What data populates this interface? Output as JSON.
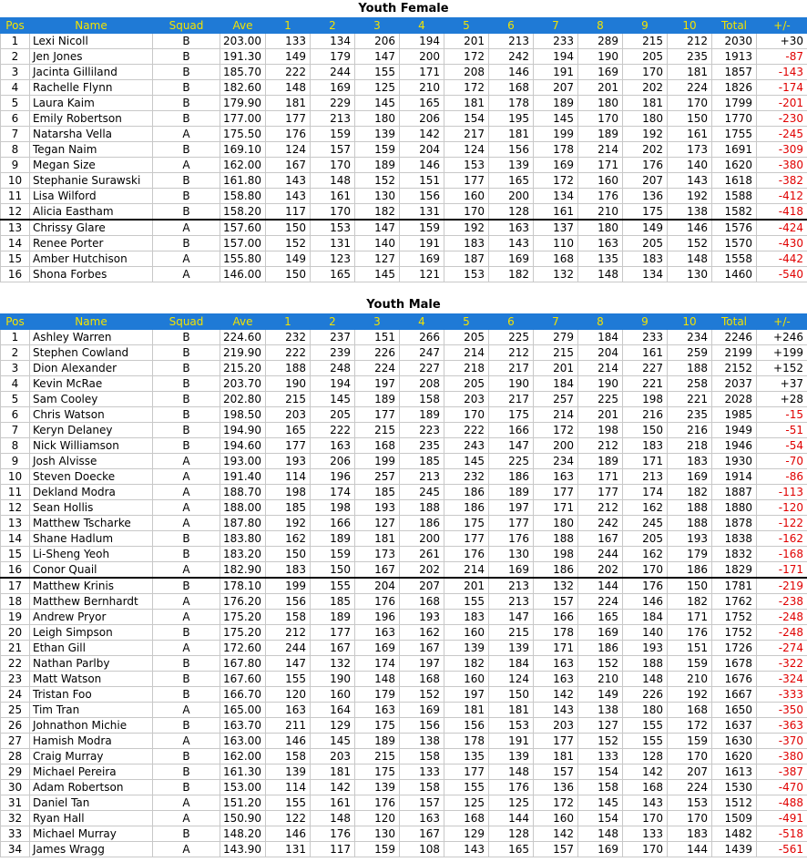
{
  "headers": [
    "Pos",
    "Name",
    "Squad",
    "Ave",
    "1",
    "2",
    "3",
    "4",
    "5",
    "6",
    "7",
    "8",
    "9",
    "10",
    "Total",
    "+/-"
  ],
  "sections": [
    {
      "title": "Youth Female",
      "cut_after": 12,
      "rows": [
        [
          "1",
          "Lexi Nicoll",
          "B",
          "203.00",
          "133",
          "134",
          "206",
          "194",
          "201",
          "213",
          "233",
          "289",
          "215",
          "212",
          "2030",
          "+30"
        ],
        [
          "2",
          "Jen Jones",
          "B",
          "191.30",
          "149",
          "179",
          "147",
          "200",
          "172",
          "242",
          "194",
          "190",
          "205",
          "235",
          "1913",
          "-87"
        ],
        [
          "3",
          "Jacinta Gilliland",
          "B",
          "185.70",
          "222",
          "244",
          "155",
          "171",
          "208",
          "146",
          "191",
          "169",
          "170",
          "181",
          "1857",
          "-143"
        ],
        [
          "4",
          "Rachelle Flynn",
          "B",
          "182.60",
          "148",
          "169",
          "125",
          "210",
          "172",
          "168",
          "207",
          "201",
          "202",
          "224",
          "1826",
          "-174"
        ],
        [
          "5",
          "Laura Kaim",
          "B",
          "179.90",
          "181",
          "229",
          "145",
          "165",
          "181",
          "178",
          "189",
          "180",
          "181",
          "170",
          "1799",
          "-201"
        ],
        [
          "6",
          "Emily Robertson",
          "B",
          "177.00",
          "177",
          "213",
          "180",
          "206",
          "154",
          "195",
          "145",
          "170",
          "180",
          "150",
          "1770",
          "-230"
        ],
        [
          "7",
          "Natarsha Vella",
          "A",
          "175.50",
          "176",
          "159",
          "139",
          "142",
          "217",
          "181",
          "199",
          "189",
          "192",
          "161",
          "1755",
          "-245"
        ],
        [
          "8",
          "Tegan Naim",
          "B",
          "169.10",
          "124",
          "157",
          "159",
          "204",
          "124",
          "156",
          "178",
          "214",
          "202",
          "173",
          "1691",
          "-309"
        ],
        [
          "9",
          "Megan Size",
          "A",
          "162.00",
          "167",
          "170",
          "189",
          "146",
          "153",
          "139",
          "169",
          "171",
          "176",
          "140",
          "1620",
          "-380"
        ],
        [
          "10",
          "Stephanie Surawski",
          "B",
          "161.80",
          "143",
          "148",
          "152",
          "151",
          "177",
          "165",
          "172",
          "160",
          "207",
          "143",
          "1618",
          "-382"
        ],
        [
          "11",
          "Lisa Wilford",
          "B",
          "158.80",
          "143",
          "161",
          "130",
          "156",
          "160",
          "200",
          "134",
          "176",
          "136",
          "192",
          "1588",
          "-412"
        ],
        [
          "12",
          "Alicia Eastham",
          "B",
          "158.20",
          "117",
          "170",
          "182",
          "131",
          "170",
          "128",
          "161",
          "210",
          "175",
          "138",
          "1582",
          "-418"
        ],
        [
          "13",
          "Chrissy Glare",
          "A",
          "157.60",
          "150",
          "153",
          "147",
          "159",
          "192",
          "163",
          "137",
          "180",
          "149",
          "146",
          "1576",
          "-424"
        ],
        [
          "14",
          "Renee Porter",
          "B",
          "157.00",
          "152",
          "131",
          "140",
          "191",
          "183",
          "143",
          "110",
          "163",
          "205",
          "152",
          "1570",
          "-430"
        ],
        [
          "15",
          "Amber Hutchison",
          "A",
          "155.80",
          "149",
          "123",
          "127",
          "169",
          "187",
          "169",
          "168",
          "135",
          "183",
          "148",
          "1558",
          "-442"
        ],
        [
          "16",
          "Shona Forbes",
          "A",
          "146.00",
          "150",
          "165",
          "145",
          "121",
          "153",
          "182",
          "132",
          "148",
          "134",
          "130",
          "1460",
          "-540"
        ]
      ]
    },
    {
      "title": "Youth Male",
      "cut_after": 16,
      "rows": [
        [
          "1",
          "Ashley Warren",
          "B",
          "224.60",
          "232",
          "237",
          "151",
          "266",
          "205",
          "225",
          "279",
          "184",
          "233",
          "234",
          "2246",
          "+246"
        ],
        [
          "2",
          "Stephen Cowland",
          "B",
          "219.90",
          "222",
          "239",
          "226",
          "247",
          "214",
          "212",
          "215",
          "204",
          "161",
          "259",
          "2199",
          "+199"
        ],
        [
          "3",
          "Dion Alexander",
          "B",
          "215.20",
          "188",
          "248",
          "224",
          "227",
          "218",
          "217",
          "201",
          "214",
          "227",
          "188",
          "2152",
          "+152"
        ],
        [
          "4",
          "Kevin McRae",
          "B",
          "203.70",
          "190",
          "194",
          "197",
          "208",
          "205",
          "190",
          "184",
          "190",
          "221",
          "258",
          "2037",
          "+37"
        ],
        [
          "5",
          "Sam Cooley",
          "B",
          "202.80",
          "215",
          "145",
          "189",
          "158",
          "203",
          "217",
          "257",
          "225",
          "198",
          "221",
          "2028",
          "+28"
        ],
        [
          "6",
          "Chris Watson",
          "B",
          "198.50",
          "203",
          "205",
          "177",
          "189",
          "170",
          "175",
          "214",
          "201",
          "216",
          "235",
          "1985",
          "-15"
        ],
        [
          "7",
          "Keryn Delaney",
          "B",
          "194.90",
          "165",
          "222",
          "215",
          "223",
          "222",
          "166",
          "172",
          "198",
          "150",
          "216",
          "1949",
          "-51"
        ],
        [
          "8",
          "Nick Williamson",
          "B",
          "194.60",
          "177",
          "163",
          "168",
          "235",
          "243",
          "147",
          "200",
          "212",
          "183",
          "218",
          "1946",
          "-54"
        ],
        [
          "9",
          "Josh Alvisse",
          "A",
          "193.00",
          "193",
          "206",
          "199",
          "185",
          "145",
          "225",
          "234",
          "189",
          "171",
          "183",
          "1930",
          "-70"
        ],
        [
          "10",
          "Steven Doecke",
          "A",
          "191.40",
          "114",
          "196",
          "257",
          "213",
          "232",
          "186",
          "163",
          "171",
          "213",
          "169",
          "1914",
          "-86"
        ],
        [
          "11",
          "Dekland Modra",
          "A",
          "188.70",
          "198",
          "174",
          "185",
          "245",
          "186",
          "189",
          "177",
          "177",
          "174",
          "182",
          "1887",
          "-113"
        ],
        [
          "12",
          "Sean Hollis",
          "A",
          "188.00",
          "185",
          "198",
          "193",
          "188",
          "186",
          "197",
          "171",
          "212",
          "162",
          "188",
          "1880",
          "-120"
        ],
        [
          "13",
          "Matthew Tscharke",
          "A",
          "187.80",
          "192",
          "166",
          "127",
          "186",
          "175",
          "177",
          "180",
          "242",
          "245",
          "188",
          "1878",
          "-122"
        ],
        [
          "14",
          "Shane Hadlum",
          "B",
          "183.80",
          "162",
          "189",
          "181",
          "200",
          "177",
          "176",
          "188",
          "167",
          "205",
          "193",
          "1838",
          "-162"
        ],
        [
          "15",
          "Li-Sheng Yeoh",
          "B",
          "183.20",
          "150",
          "159",
          "173",
          "261",
          "176",
          "130",
          "198",
          "244",
          "162",
          "179",
          "1832",
          "-168"
        ],
        [
          "16",
          "Conor Quail",
          "A",
          "182.90",
          "183",
          "150",
          "167",
          "202",
          "214",
          "169",
          "186",
          "202",
          "170",
          "186",
          "1829",
          "-171"
        ],
        [
          "17",
          "Matthew Krinis",
          "B",
          "178.10",
          "199",
          "155",
          "204",
          "207",
          "201",
          "213",
          "132",
          "144",
          "176",
          "150",
          "1781",
          "-219"
        ],
        [
          "18",
          "Matthew Bernhardt",
          "A",
          "176.20",
          "156",
          "185",
          "176",
          "168",
          "155",
          "213",
          "157",
          "224",
          "146",
          "182",
          "1762",
          "-238"
        ],
        [
          "19",
          "Andrew Pryor",
          "A",
          "175.20",
          "158",
          "189",
          "196",
          "193",
          "183",
          "147",
          "166",
          "165",
          "184",
          "171",
          "1752",
          "-248"
        ],
        [
          "20",
          "Leigh Simpson",
          "B",
          "175.20",
          "212",
          "177",
          "163",
          "162",
          "160",
          "215",
          "178",
          "169",
          "140",
          "176",
          "1752",
          "-248"
        ],
        [
          "21",
          "Ethan Gill",
          "A",
          "172.60",
          "244",
          "167",
          "169",
          "167",
          "139",
          "139",
          "171",
          "186",
          "193",
          "151",
          "1726",
          "-274"
        ],
        [
          "22",
          "Nathan Parlby",
          "B",
          "167.80",
          "147",
          "132",
          "174",
          "197",
          "182",
          "184",
          "163",
          "152",
          "188",
          "159",
          "1678",
          "-322"
        ],
        [
          "23",
          "Matt Watson",
          "B",
          "167.60",
          "155",
          "190",
          "148",
          "168",
          "160",
          "124",
          "163",
          "210",
          "148",
          "210",
          "1676",
          "-324"
        ],
        [
          "24",
          "Tristan Foo",
          "B",
          "166.70",
          "120",
          "160",
          "179",
          "152",
          "197",
          "150",
          "142",
          "149",
          "226",
          "192",
          "1667",
          "-333"
        ],
        [
          "25",
          "Tim Tran",
          "A",
          "165.00",
          "163",
          "164",
          "163",
          "169",
          "181",
          "181",
          "143",
          "138",
          "180",
          "168",
          "1650",
          "-350"
        ],
        [
          "26",
          "Johnathon Michie",
          "B",
          "163.70",
          "211",
          "129",
          "175",
          "156",
          "156",
          "153",
          "203",
          "127",
          "155",
          "172",
          "1637",
          "-363"
        ],
        [
          "27",
          "Hamish Modra",
          "A",
          "163.00",
          "146",
          "145",
          "189",
          "138",
          "178",
          "191",
          "177",
          "152",
          "155",
          "159",
          "1630",
          "-370"
        ],
        [
          "28",
          "Craig Murray",
          "B",
          "162.00",
          "158",
          "203",
          "215",
          "158",
          "135",
          "139",
          "181",
          "133",
          "128",
          "170",
          "1620",
          "-380"
        ],
        [
          "29",
          "Michael Pereira",
          "B",
          "161.30",
          "139",
          "181",
          "175",
          "133",
          "177",
          "148",
          "157",
          "154",
          "142",
          "207",
          "1613",
          "-387"
        ],
        [
          "30",
          "Adam Robertson",
          "B",
          "153.00",
          "114",
          "142",
          "139",
          "158",
          "155",
          "176",
          "136",
          "158",
          "168",
          "224",
          "1530",
          "-470"
        ],
        [
          "31",
          "Daniel Tan",
          "A",
          "151.20",
          "155",
          "161",
          "176",
          "157",
          "125",
          "125",
          "172",
          "145",
          "143",
          "153",
          "1512",
          "-488"
        ],
        [
          "32",
          "Ryan Hall",
          "A",
          "150.90",
          "122",
          "148",
          "120",
          "163",
          "168",
          "144",
          "160",
          "154",
          "170",
          "170",
          "1509",
          "-491"
        ],
        [
          "33",
          "Michael Murray",
          "B",
          "148.20",
          "146",
          "176",
          "130",
          "167",
          "129",
          "128",
          "142",
          "148",
          "133",
          "183",
          "1482",
          "-518"
        ],
        [
          "34",
          "James Wragg",
          "A",
          "143.90",
          "131",
          "117",
          "159",
          "108",
          "143",
          "165",
          "157",
          "169",
          "170",
          "144",
          "1439",
          "-561"
        ]
      ]
    }
  ]
}
